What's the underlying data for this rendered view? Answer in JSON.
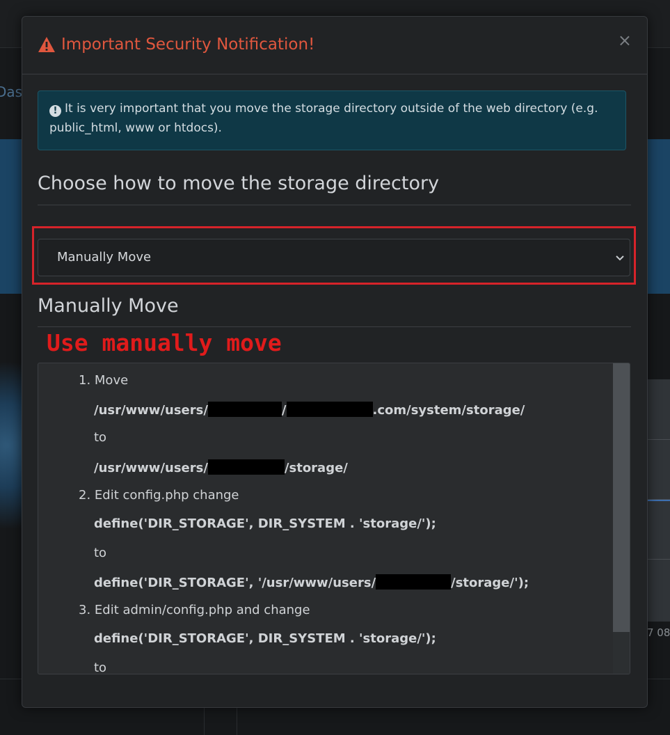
{
  "background": {
    "left_text": "Dasl",
    "chart_ticks": "7  08"
  },
  "modal": {
    "title": "Important Security Notification!",
    "close_label": "×",
    "info_text": "It is very important that you move the storage directory outside of the web directory (e.g. public_html, www or htdocs).",
    "choose_heading": "Choose how to move the storage directory",
    "select_value": "Manually Move",
    "section_heading": "Manually Move",
    "annotation": "Use manually move",
    "steps": {
      "s1_label": "1. Move",
      "s1_path_a1": "/usr/www/users/",
      "s1_path_a2": "/",
      "s1_path_a3": ".com/system/storage/",
      "s1_to": "to",
      "s1_path_b1": "/usr/www/users/",
      "s1_path_b2": "/storage/",
      "s2_label": "2. Edit config.php change",
      "s2_code_a": "define('DIR_STORAGE', DIR_SYSTEM . 'storage/');",
      "s2_to": "to",
      "s2_code_b1": "define('DIR_STORAGE', '/usr/www/users/",
      "s2_code_b2": "/storage/');",
      "s3_label": "3. Edit admin/config.php and change",
      "s3_code_a": "define('DIR_STORAGE', DIR_SYSTEM . 'storage/');",
      "s3_to": "to"
    }
  },
  "colors": {
    "title": "#e0573e",
    "annotation": "#e01b1b",
    "highlight_border": "#d6232a",
    "info_bg": "#0f3846"
  },
  "icons": {
    "title_icon": "warning-triangle-icon",
    "info_icon": "exclamation-circle-icon",
    "select_icon": "chevron-down-icon"
  }
}
